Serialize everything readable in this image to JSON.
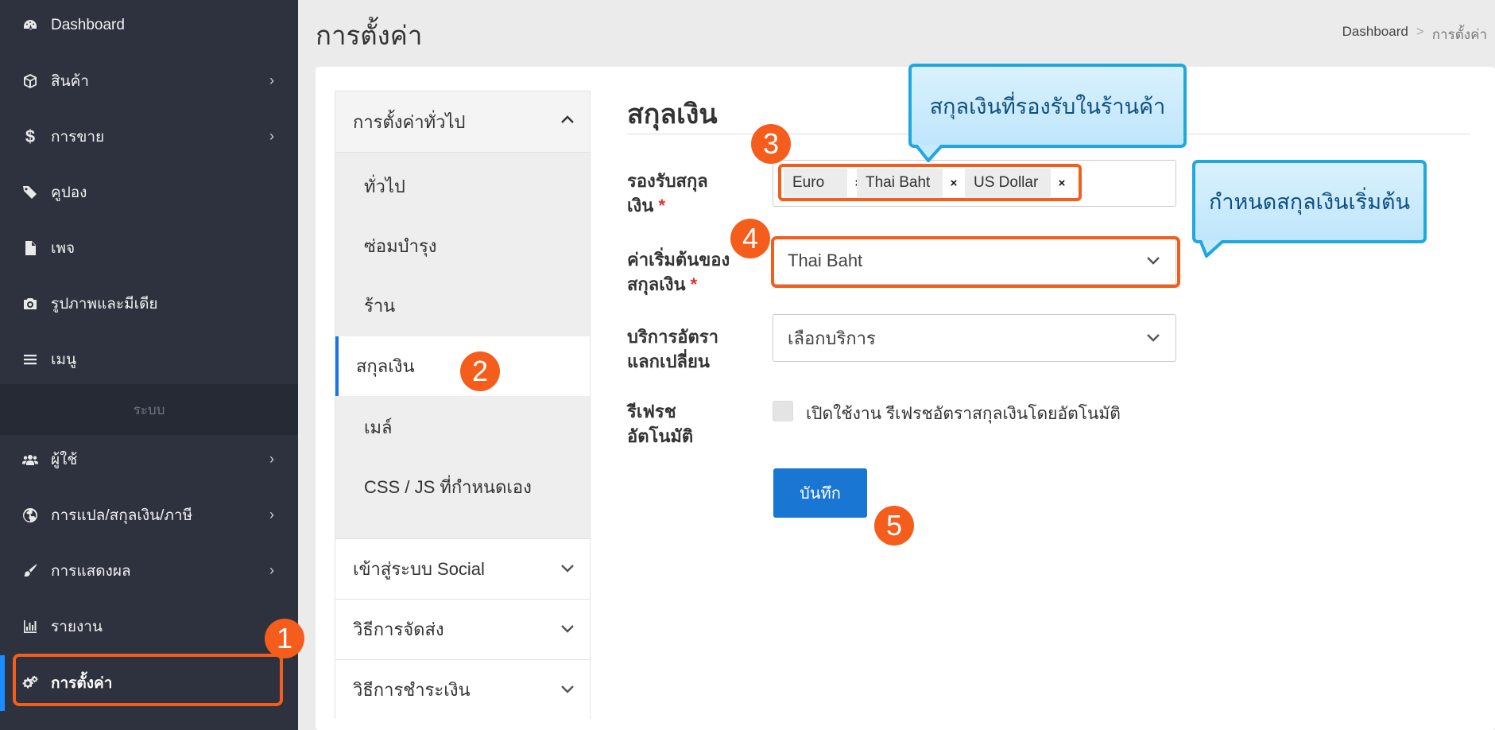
{
  "sidebar": {
    "items": [
      {
        "label": "Dashboard",
        "icon": "dashboard-icon",
        "has_children": false
      },
      {
        "label": "สินค้า",
        "icon": "cube-icon",
        "has_children": true
      },
      {
        "label": "การขาย",
        "icon": "dollar-icon",
        "has_children": true
      },
      {
        "label": "คูปอง",
        "icon": "tags-icon",
        "has_children": false
      },
      {
        "label": "เพจ",
        "icon": "file-icon",
        "has_children": false
      },
      {
        "label": "รูปภาพและมีเดีย",
        "icon": "camera-icon",
        "has_children": false
      },
      {
        "label": "เมนู",
        "icon": "bars-icon",
        "has_children": false
      }
    ],
    "section_label": "ระบบ",
    "system_items": [
      {
        "label": "ผู้ใช้",
        "icon": "users-icon",
        "has_children": true
      },
      {
        "label": "การแปล/สกุลเงิน/ภาษี",
        "icon": "globe-icon",
        "has_children": true
      },
      {
        "label": "การแสดงผล",
        "icon": "paintbrush-icon",
        "has_children": true
      },
      {
        "label": "รายงาน",
        "icon": "bar-chart-icon",
        "has_children": false
      },
      {
        "label": "การตั้งค่า",
        "icon": "cogs-icon",
        "has_children": false,
        "active": true
      }
    ]
  },
  "header": {
    "title": "การตั้งค่า",
    "breadcrumb": [
      "Dashboard",
      "การตั้งค่า"
    ],
    "breadcrumb_sep": ">"
  },
  "settings_nav": {
    "group_title": "การตั้งค่าทั่วไป",
    "items": [
      "ทั่วไป",
      "ซ่อมบำรุง",
      "ร้าน",
      "สกุลเงิน",
      "เมล์",
      "CSS / JS ที่กำหนดเอง"
    ],
    "active_item": "สกุลเงิน",
    "collapsed_groups": [
      "เข้าสู่ระบบ Social",
      "วิธีการจัดส่ง",
      "วิธีการชำระเงิน"
    ]
  },
  "form": {
    "section_title": "สกุลเงิน",
    "supported_label_1": "รองรับสกุล",
    "supported_label_2": "เงิน",
    "supported_values": [
      "Euro",
      "Thai Baht",
      "US Dollar"
    ],
    "remove_symbol": "×",
    "default_label_1": "ค่าเริ่มต้นของ",
    "default_label_2": "สกุลเงิน",
    "default_value": "Thai Baht",
    "exchange_label_1": "บริการอัตรา",
    "exchange_label_2": "แลกเปลี่ยน",
    "exchange_placeholder": "เลือกบริการ",
    "refresh_label_1": "รีเฟรช",
    "refresh_label_2": "อัตโนมัติ",
    "refresh_checkbox_label": "เปิดใช้งาน รีเฟรชอัตราสกุลเงินโดยอัตโนมัติ",
    "refresh_checked": false,
    "required_mark": "*",
    "save_label": "บันทึก"
  },
  "annotations": {
    "badges": [
      "1",
      "2",
      "3",
      "4",
      "5"
    ],
    "callout_supported": "สกุลเงินที่รองรับในร้านค้า",
    "callout_default": "กำหนดสกุลเงินเริ่มต้น",
    "accent_color": "#f45d1c",
    "callout_color": "#1fa8e0"
  }
}
